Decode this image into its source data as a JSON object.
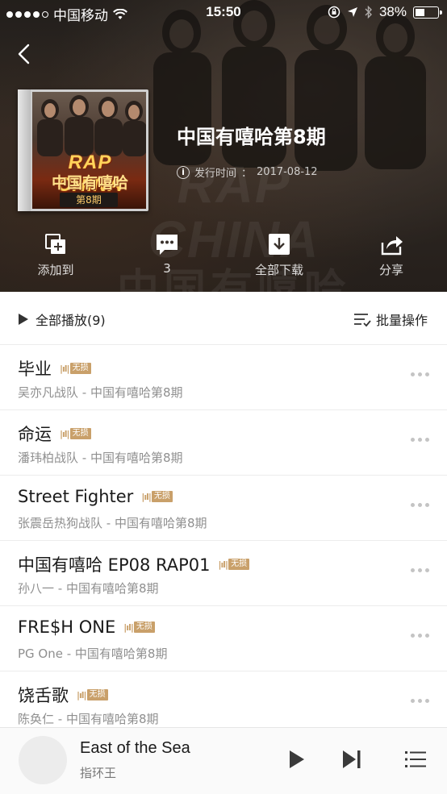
{
  "status_bar": {
    "carrier": "中国移动",
    "time": "15:50",
    "battery": "38%"
  },
  "album": {
    "title": "中国有嘻哈第8期",
    "release_label": "发行时间",
    "release_date": "2017-08-12",
    "cover_text_1": "RAP CHINA",
    "cover_text_2": "中国有嘻哈",
    "cover_episode": "第8期"
  },
  "actions": [
    {
      "label": "添加到",
      "icon": "add-to-icon"
    },
    {
      "label": "3",
      "icon": "comment-icon"
    },
    {
      "label": "全部下载",
      "icon": "download-icon"
    },
    {
      "label": "分享",
      "icon": "share-icon"
    }
  ],
  "play_all": {
    "label": "全部播放(9)",
    "batch_label": "批量操作"
  },
  "lossless_tag": "无损",
  "tracks": [
    {
      "title": "毕业",
      "subtitle": "吴亦凡战队 - 中国有嘻哈第8期"
    },
    {
      "title": "命运",
      "subtitle": "潘玮柏战队 - 中国有嘻哈第8期"
    },
    {
      "title": "Street Fighter",
      "subtitle": "张震岳热狗战队 - 中国有嘻哈第8期"
    },
    {
      "title": "中国有嘻哈 EP08 RAP01",
      "subtitle": "孙八一 - 中国有嘻哈第8期"
    },
    {
      "title": "FRE$H ONE",
      "subtitle": "PG One - 中国有嘻哈第8期"
    },
    {
      "title": "饶舌歌",
      "subtitle": "陈奂仁 - 中国有嘻哈第8期"
    }
  ],
  "now_playing": {
    "song": "East of the Sea",
    "artist": "指环王"
  },
  "colors": {
    "lossless": "#c9a06a",
    "header_bg": "#2f2823"
  }
}
